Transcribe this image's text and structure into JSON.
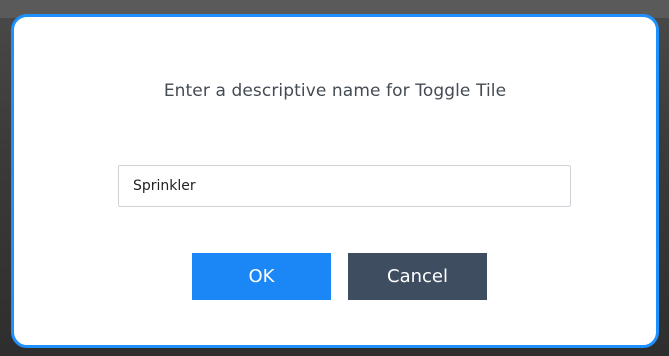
{
  "dialog": {
    "prompt": "Enter a descriptive name for Toggle Tile",
    "name_input": {
      "value": "Sprinkler",
      "placeholder": ""
    },
    "ok_label": "OK",
    "cancel_label": "Cancel"
  },
  "colors": {
    "accent": "#1e90ff",
    "ok_button": "#1b87f7",
    "cancel_button": "#3e4e60",
    "prompt_text": "#444b53"
  }
}
